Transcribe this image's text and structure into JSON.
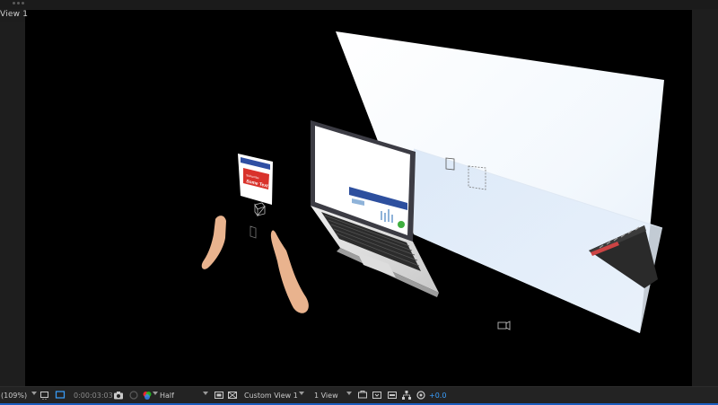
{
  "view": {
    "label": "View 1"
  },
  "scene": {
    "poster": {
      "line1": "Subscribe",
      "line2": "Some Text"
    }
  },
  "bottom_bar": {
    "zoom": "(109%)",
    "timecode": "0:00:03:03",
    "resolution": "Half",
    "camera_view": "Custom View 1",
    "views_layout": "1 View",
    "exposure": "+0.0"
  },
  "colors": {
    "accent": "#3aa0ff",
    "viewport_bg": "#000000",
    "panel_bg": "#232323"
  },
  "icons": [
    "camera-icon",
    "color-channel-icon",
    "region-of-interest-icon",
    "transparency-grid-icon",
    "fast-previews-icon",
    "flowchart-icon",
    "reset-exposure-icon",
    "snapshot-icon"
  ]
}
